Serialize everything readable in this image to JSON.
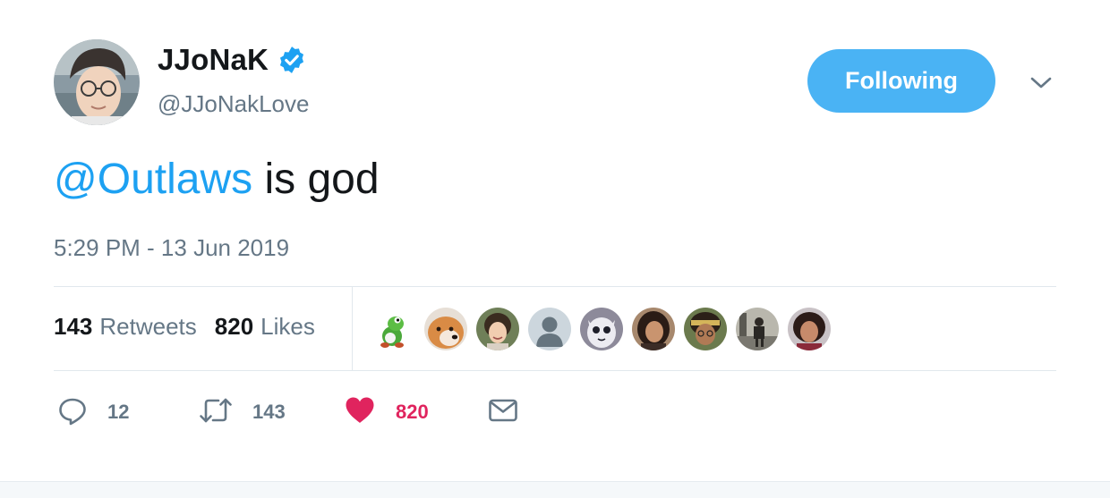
{
  "tweet": {
    "author": {
      "name": "JJoNaK",
      "handle": "@JJoNakLove",
      "verified": true,
      "avatar_icon": "author-avatar"
    },
    "follow_button_label": "Following",
    "menu_icon": "chevron-down-icon",
    "text": {
      "mention": "@Outlaws",
      "rest": " is god"
    },
    "timestamp": "5:29 PM - 13 Jun 2019",
    "stats": {
      "retweets": {
        "count": "143",
        "label": "Retweets"
      },
      "likes": {
        "count": "820",
        "label": "Likes"
      }
    },
    "liked_by_avatars": [
      "yoshi-avatar",
      "shiba-dog-avatar",
      "woman-smiling-avatar",
      "default-user-avatar",
      "cartoon-owl-avatar",
      "woman-dark-hair-avatar",
      "woman-headband-avatar",
      "person-street-avatar",
      "woman-curly-hair-avatar"
    ],
    "actions": {
      "reply": {
        "icon": "reply-icon",
        "count": "12"
      },
      "retweet": {
        "icon": "retweet-icon",
        "count": "143"
      },
      "like": {
        "icon": "heart-icon",
        "count": "820",
        "active": true
      },
      "dm": {
        "icon": "mail-icon"
      }
    },
    "colors": {
      "accent": "#1da1f2",
      "follow_button": "#4ab3f4",
      "secondary_text": "#657786",
      "like_active": "#e0245e",
      "divider": "#e1e8ed"
    }
  }
}
